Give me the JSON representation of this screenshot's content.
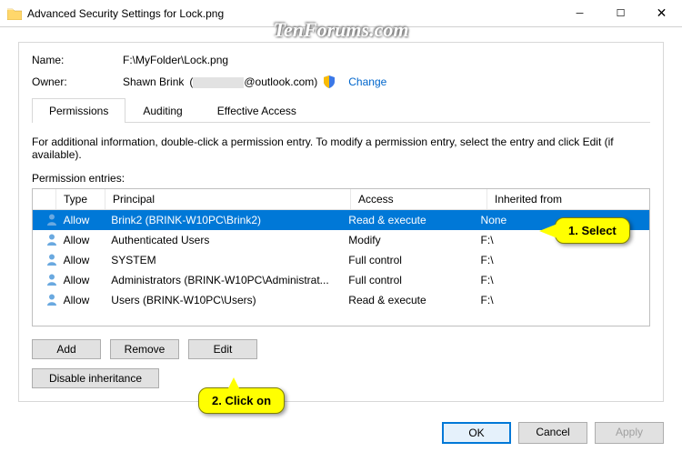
{
  "window": {
    "title": "Advanced Security Settings for Lock.png"
  },
  "watermark": "TenForums.com",
  "header": {
    "name_label": "Name:",
    "name_value": "F:\\MyFolder\\Lock.png",
    "owner_label": "Owner:",
    "owner_value_prefix": "Shawn Brink",
    "owner_value_suffix": "@outlook.com)",
    "change_link": "Change"
  },
  "tabs": {
    "permissions": "Permissions",
    "auditing": "Auditing",
    "effective": "Effective Access"
  },
  "info_text": "For additional information, double-click a permission entry. To modify a permission entry, select the entry and click Edit (if available).",
  "entries_label": "Permission entries:",
  "columns": {
    "type": "Type",
    "principal": "Principal",
    "access": "Access",
    "inherited": "Inherited from"
  },
  "entries": [
    {
      "type": "Allow",
      "principal": "Brink2 (BRINK-W10PC\\Brink2)",
      "access": "Read & execute",
      "inherited": "None"
    },
    {
      "type": "Allow",
      "principal": "Authenticated Users",
      "access": "Modify",
      "inherited": "F:\\"
    },
    {
      "type": "Allow",
      "principal": "SYSTEM",
      "access": "Full control",
      "inherited": "F:\\"
    },
    {
      "type": "Allow",
      "principal": "Administrators (BRINK-W10PC\\Administrat...",
      "access": "Full control",
      "inherited": "F:\\"
    },
    {
      "type": "Allow",
      "principal": "Users (BRINK-W10PC\\Users)",
      "access": "Read & execute",
      "inherited": "F:\\"
    }
  ],
  "buttons": {
    "add": "Add",
    "remove": "Remove",
    "edit": "Edit",
    "disable_inheritance": "Disable inheritance",
    "ok": "OK",
    "cancel": "Cancel",
    "apply": "Apply"
  },
  "callouts": {
    "select": "1.  Select",
    "click_on": "2.  Click on"
  }
}
